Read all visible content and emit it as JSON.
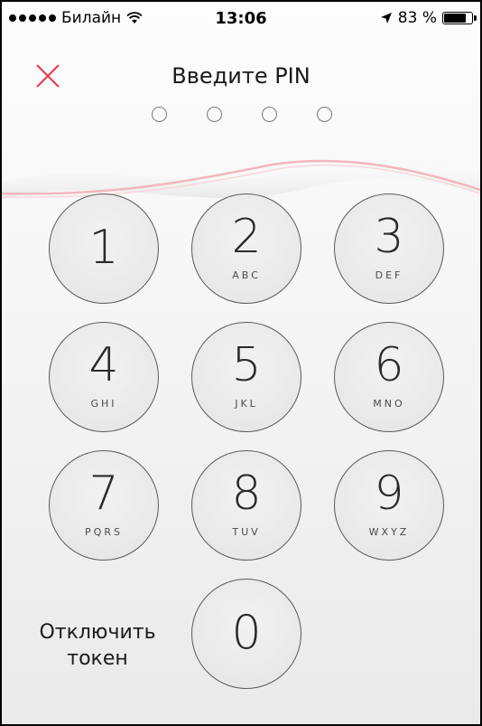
{
  "status_bar": {
    "carrier": "Билайн",
    "time": "13:06",
    "battery_text": "83 %",
    "battery_level": 0.83,
    "signal_bars": 5
  },
  "header": {
    "title": "Введите PIN",
    "close_icon": "close-icon",
    "close_color": "#e8384f"
  },
  "pin": {
    "length": 4,
    "entered": 0
  },
  "keypad": {
    "keys": [
      {
        "digit": "1",
        "letters": ""
      },
      {
        "digit": "2",
        "letters": "ABC"
      },
      {
        "digit": "3",
        "letters": "DEF"
      },
      {
        "digit": "4",
        "letters": "GHI"
      },
      {
        "digit": "5",
        "letters": "JKL"
      },
      {
        "digit": "6",
        "letters": "MNO"
      },
      {
        "digit": "7",
        "letters": "PQRS"
      },
      {
        "digit": "8",
        "letters": "TUV"
      },
      {
        "digit": "9",
        "letters": "WXYZ"
      },
      {
        "digit": "0",
        "letters": ""
      }
    ]
  },
  "footer": {
    "disable_token_label": "Отключить\nтокен"
  },
  "colors": {
    "accent": "#e8384f",
    "wave": "#f2b7bd"
  }
}
